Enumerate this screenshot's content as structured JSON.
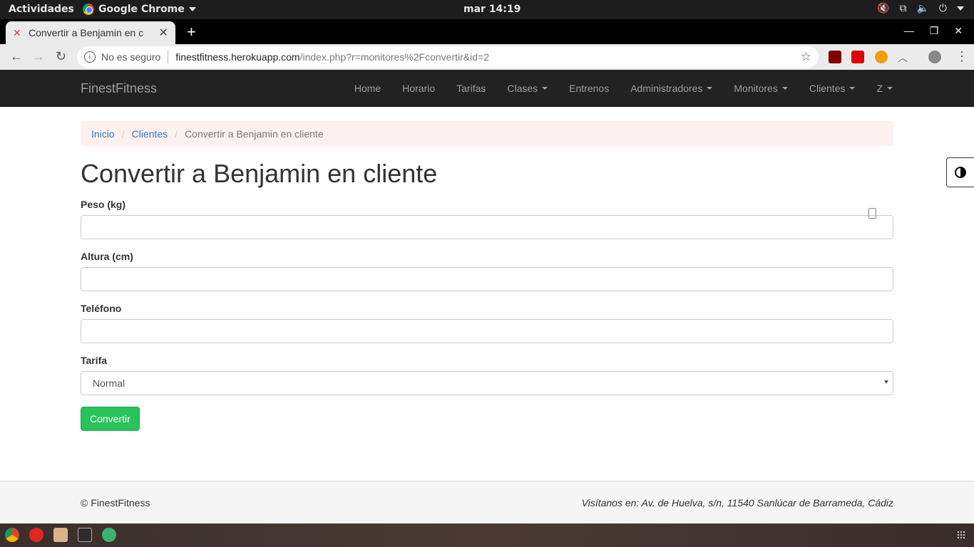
{
  "system": {
    "activities": "Actividades",
    "app_name": "Google Chrome",
    "clock": "mar 14:19"
  },
  "browser": {
    "tab_title": "Convertir a Benjamin en c",
    "security_label": "No es seguro",
    "url_host": "finestfitness.herokuapp.com",
    "url_path": "/index.php?r=monitores%2Fconvertir&id=2"
  },
  "navbar": {
    "brand": "FinestFitness",
    "items": [
      {
        "label": "Home",
        "dropdown": false
      },
      {
        "label": "Horario",
        "dropdown": false
      },
      {
        "label": "Tarifas",
        "dropdown": false
      },
      {
        "label": "Clases",
        "dropdown": true
      },
      {
        "label": "Entrenos",
        "dropdown": false
      },
      {
        "label": "Administradores",
        "dropdown": true
      },
      {
        "label": "Monitores",
        "dropdown": true
      },
      {
        "label": "Clientes",
        "dropdown": true
      },
      {
        "label": "Z",
        "dropdown": true
      }
    ]
  },
  "breadcrumb": {
    "home": "Inicio",
    "section": "Clientes",
    "current": "Convertir a Benjamin en cliente"
  },
  "page": {
    "title": "Convertir a Benjamin en cliente"
  },
  "form": {
    "peso_label": "Peso (kg)",
    "peso_value": "",
    "altura_label": "Altura (cm)",
    "altura_value": "",
    "telefono_label": "Teléfono",
    "telefono_value": "",
    "tarifa_label": "Tarifa",
    "tarifa_selected": "Normal",
    "submit_label": "Convertir"
  },
  "footer": {
    "copyright": "© FinestFitness",
    "address": "Visítanos en: Av. de Huelva, s/n, 11540 Sanlúcar de Barrameda, Cádiz"
  }
}
